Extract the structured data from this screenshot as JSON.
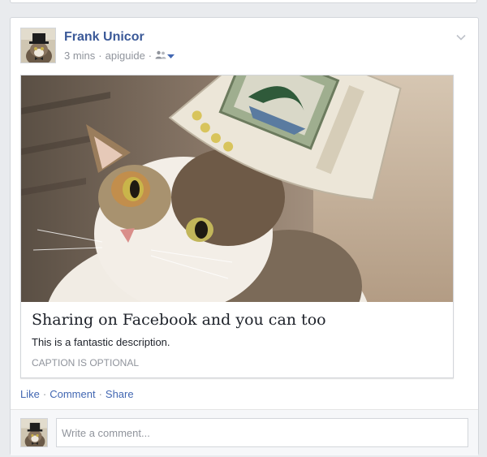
{
  "post": {
    "author": "Frank Unicor",
    "time": "3 mins",
    "source": "apiguide",
    "separator": "·",
    "icons": {
      "audience": "friends-icon",
      "dropdown": "caret-down-icon",
      "options": "chevron-down-icon"
    }
  },
  "share": {
    "title": "Sharing on Facebook and you can too",
    "description": "This is a fantastic description.",
    "caption": "CAPTION IS OPTIONAL",
    "image": "cat-wearing-paper-cup-hat"
  },
  "actions": {
    "like": "Like",
    "comment": "Comment",
    "share": "Share",
    "separator": "·"
  },
  "composer": {
    "placeholder": "Write a comment..."
  },
  "colors": {
    "link": "#3b5998",
    "action": "#4267b2",
    "meta": "#90949c",
    "border": "#d3d6db",
    "background": "#e9ebee"
  }
}
